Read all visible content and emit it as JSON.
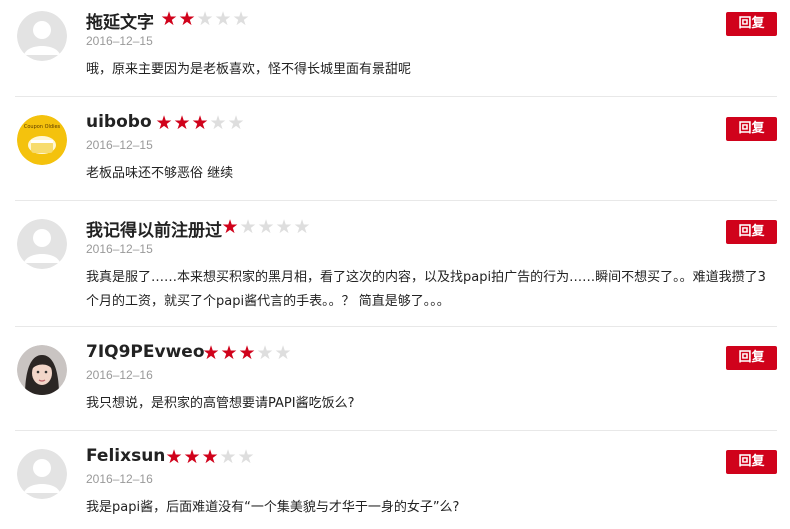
{
  "reply_label": "回复",
  "colors": {
    "accent": "#d0021b",
    "star_empty": "#dedede",
    "date": "#999999"
  },
  "comments": [
    {
      "username": "拖延文字",
      "rating": 2,
      "max_rating": 5,
      "date": "2016–12–15",
      "text": "哦，原来主要因为是老板喜欢，怪不得长城里面有景甜呢",
      "avatar": "default-avatar"
    },
    {
      "username": "uibobo",
      "rating": 3,
      "max_rating": 5,
      "date": "2016–12–15",
      "text": "老板品味还不够恶俗 继续",
      "avatar": "yellow-logo-avatar",
      "avatar_text": "Coupon Oldies"
    },
    {
      "username": "我记得以前注册过",
      "rating": 1,
      "max_rating": 5,
      "date": "2016–12–15",
      "text": "我真是服了……本来想买积家的黑月相，看了这次的内容，以及找papi拍广告的行为……瞬间不想买了。。难道我攒了3个月的工资，就买了个papi酱代言的手表。。？ 简直是够了。。。",
      "avatar": "default-avatar"
    },
    {
      "username": "7IQ9PEvweo",
      "rating": 3,
      "max_rating": 5,
      "date": "2016–12–16",
      "text": "我只想说，是积家的高管想要请PAPI酱吃饭么?",
      "avatar": "photo-avatar"
    },
    {
      "username": "Felixsun",
      "rating": 3,
      "max_rating": 5,
      "date": "2016–12–16",
      "text": "我是papi酱，后面难道没有“一个集美貌与才华于一身的女子”么?",
      "avatar": "default-avatar"
    }
  ]
}
